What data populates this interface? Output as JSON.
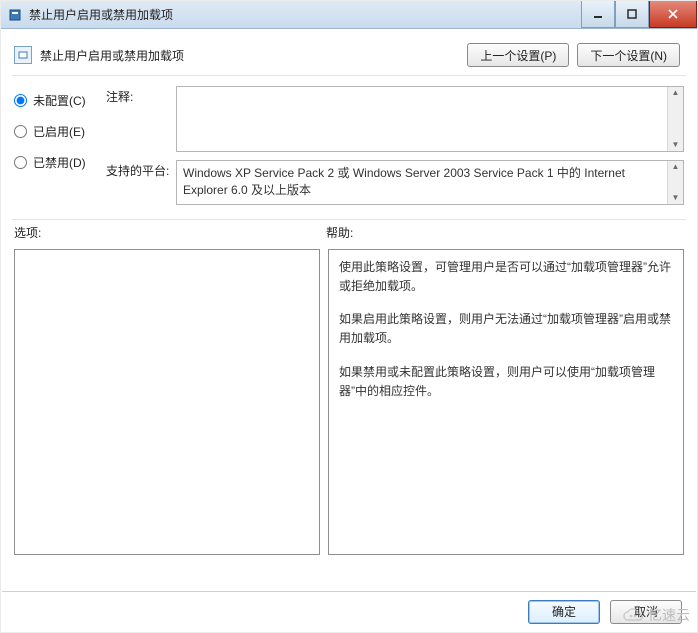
{
  "window": {
    "title": "禁止用户启用或禁用加载项"
  },
  "header": {
    "policy_title": "禁止用户启用或禁用加载项",
    "prev_label": "上一个设置(P)",
    "next_label": "下一个设置(N)"
  },
  "config": {
    "radios": {
      "not_configured": "未配置(C)",
      "enabled": "已启用(E)",
      "disabled": "已禁用(D)",
      "selected": "not_configured"
    },
    "annotation_label": "注释:",
    "annotation_value": "",
    "platform_label": "支持的平台:",
    "platform_value": "Windows XP Service Pack 2 或 Windows Server 2003 Service Pack 1 中的 Internet Explorer 6.0 及以上版本"
  },
  "sections": {
    "options_label": "选项:",
    "help_label": "帮助:"
  },
  "help": {
    "p1": "使用此策略设置，可管理用户是否可以通过“加载项管理器”允许或拒绝加载项。",
    "p2": "如果启用此策略设置，则用户无法通过“加载项管理器”启用或禁用加载项。",
    "p3": "如果禁用或未配置此策略设置，则用户可以使用“加载项管理器”中的相应控件。"
  },
  "buttons": {
    "ok": "确定",
    "cancel": "取消"
  },
  "watermark": {
    "text": "亿速云"
  }
}
